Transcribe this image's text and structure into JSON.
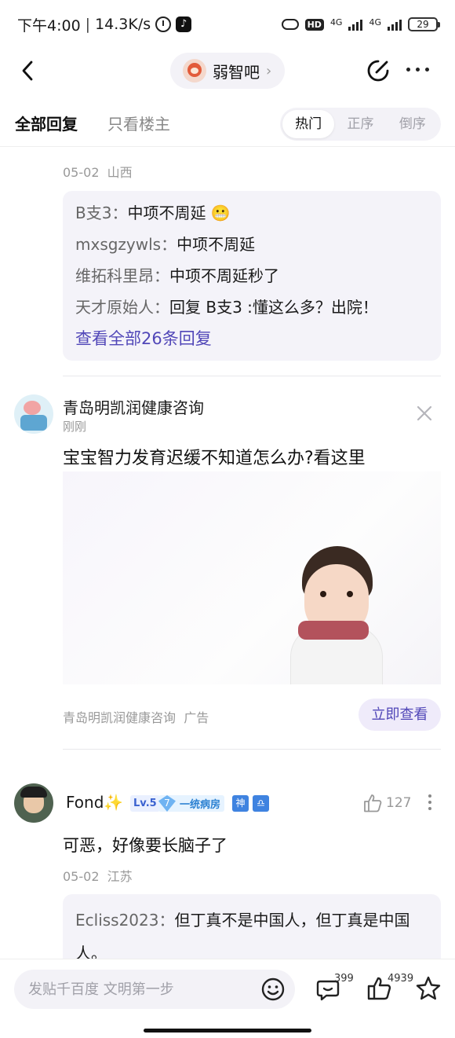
{
  "status_bar": {
    "time": "下午4:00",
    "speed": "14.3K/s",
    "hd": "HD",
    "network_1": "4G",
    "network_2": "4G",
    "battery": "29"
  },
  "nav": {
    "forum_name": "弱智吧"
  },
  "tabs": {
    "all_replies": "全部回复",
    "op_only": "只看楼主",
    "sort": [
      "热门",
      "正序",
      "倒序"
    ]
  },
  "post1": {
    "date": "05-02",
    "location": "山西",
    "replies": [
      {
        "name": "B支3",
        "sep": "：",
        "text": "中项不周延 😬"
      },
      {
        "name": "mxsgzywls",
        "sep": "：",
        "text": "中项不周延"
      },
      {
        "name": "维拓科里昂",
        "sep": "：",
        "text": "中项不周延秒了"
      },
      {
        "name": "天才原始人",
        "sep": "：",
        "text": "回复 B支3 :懂这么多？出院！"
      }
    ],
    "view_all": "查看全部26条回复"
  },
  "ad": {
    "name": "青岛明凯润健康咨询",
    "time": "刚刚",
    "text": "宝宝智力发育迟缓不知道怎么办?看这里",
    "source": "青岛明凯润健康咨询",
    "tag": "广告",
    "button": "立即查看"
  },
  "comment2": {
    "name": "Fond",
    "sparkle": "✨",
    "level": "Lv.5",
    "rank_number": "7",
    "rank_title": "一统病房",
    "badge_1": "神",
    "badge_2": "♎",
    "likes": "127",
    "text": "可恶，好像要长脑子了",
    "date": "05-02",
    "location": "江苏",
    "reply_name": "Ecliss2023",
    "reply_sep": "：",
    "reply_text": "但丁真不是中国人，但丁真是中国人。"
  },
  "bottom_bar": {
    "input_placeholder": "发贴千百度 文明第一步",
    "comment_count": "399",
    "like_count": "4939"
  },
  "colors": {
    "accent": "#5147b8",
    "reply_bg": "#f4f3f9"
  }
}
